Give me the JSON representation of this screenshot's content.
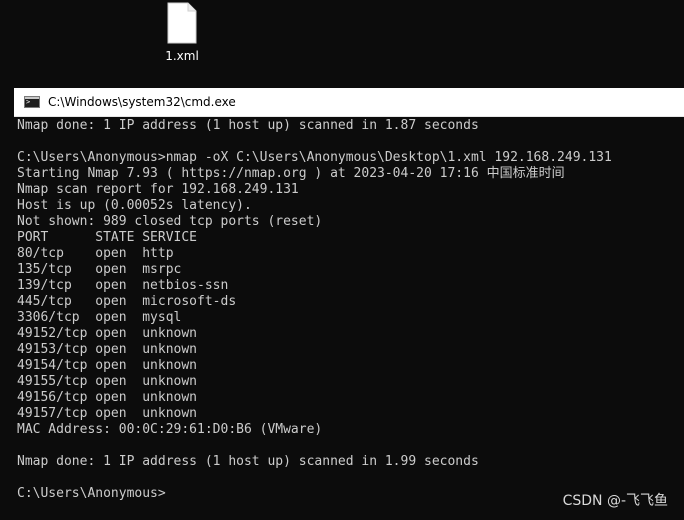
{
  "desktop": {
    "file_icon": "document-icon",
    "file_name": "1.xml"
  },
  "window": {
    "app_icon": "console-icon",
    "title": "C:\\Windows\\system32\\cmd.exe"
  },
  "console": {
    "lines": [
      "Nmap done: 1 IP address (1 host up) scanned in 1.87 seconds",
      "",
      "C:\\Users\\Anonymous>nmap -oX C:\\Users\\Anonymous\\Desktop\\1.xml 192.168.249.131",
      "Starting Nmap 7.93 ( https://nmap.org ) at 2023-04-20 17:16 中国标准时间",
      "Nmap scan report for 192.168.249.131",
      "Host is up (0.00052s latency).",
      "Not shown: 989 closed tcp ports (reset)",
      "PORT      STATE SERVICE",
      "80/tcp    open  http",
      "135/tcp   open  msrpc",
      "139/tcp   open  netbios-ssn",
      "445/tcp   open  microsoft-ds",
      "3306/tcp  open  mysql",
      "49152/tcp open  unknown",
      "49153/tcp open  unknown",
      "49154/tcp open  unknown",
      "49155/tcp open  unknown",
      "49156/tcp open  unknown",
      "49157/tcp open  unknown",
      "MAC Address: 00:0C:29:61:D0:B6 (VMware)",
      "",
      "Nmap done: 1 IP address (1 host up) scanned in 1.99 seconds",
      "",
      "C:\\Users\\Anonymous>"
    ]
  },
  "watermark": "CSDN @-飞飞鱼",
  "colors": {
    "console_bg": "#0c0c0c",
    "console_text": "#cccccc",
    "titlebar_bg": "#ffffff"
  }
}
